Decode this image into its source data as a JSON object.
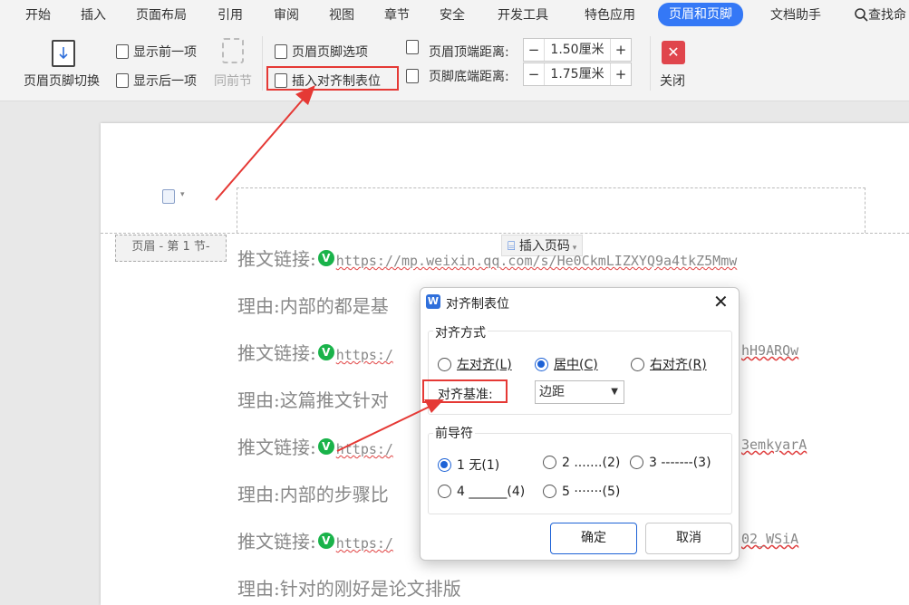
{
  "menu": {
    "tabs": [
      "开始",
      "插入",
      "页面布局",
      "引用",
      "审阅",
      "视图",
      "章节",
      "安全",
      "开发工具",
      "特色应用",
      "页眉和页脚",
      "文档助手"
    ],
    "active_tab": "页眉和页脚",
    "search_label": "查找命"
  },
  "ribbon": {
    "switch_label": "页眉页脚切换",
    "show_prev": "显示前一项",
    "show_next": "显示后一项",
    "same_section": "同前节",
    "hf_options": "页眉页脚选项",
    "insert_tab": "插入对齐制表位",
    "header_top_label": "页眉顶端距离:",
    "header_top_value": "1.50厘米",
    "footer_bottom_label": "页脚底端距离:",
    "footer_bottom_value": "1.75厘米",
    "minus": "−",
    "plus": "+",
    "close_label": "关闭",
    "close_icon": "✕"
  },
  "document": {
    "header_tag": "页眉 - 第 1 节-",
    "insert_page_number": "插入页码",
    "lines": [
      {
        "prefix": "推文链接:",
        "link": "https://mp.weixin.qq.com/s/He0CkmLIZXYQ9a4tkZ5Mmw"
      },
      {
        "prefix": "理由:内部的都是基"
      },
      {
        "prefix": "推文链接:",
        "link": "https:/",
        "tail": "hH9ARQw"
      },
      {
        "prefix": "理由:这篇推文针对"
      },
      {
        "prefix": "推文链接:",
        "link": "https:/",
        "tail": "3emkyarA"
      },
      {
        "prefix": "理由:内部的步骤比"
      },
      {
        "prefix": "推文链接:",
        "link": "https:/",
        "tail": "02_WSiA"
      },
      {
        "prefix": "理由:针对的刚好是论文排版"
      }
    ]
  },
  "dialog": {
    "title": "对齐制表位",
    "close_icon": "✕",
    "align_group": "对齐方式",
    "align_left": "左对齐(L)",
    "align_center": "居中(C)",
    "align_right": "右对齐(R)",
    "align_base_label": "对齐基准:",
    "align_base_value": "边距",
    "leader_group": "前导符",
    "leader_1": "1 无(1)",
    "leader_2": "2 .......(2)",
    "leader_3": "3 -------(3)",
    "leader_4": "4 ______(4)",
    "leader_5": "5 ·······(5)",
    "ok": "确定",
    "cancel": "取消"
  },
  "colors": {
    "accent": "#3478f6",
    "annotation_red": "#e53935",
    "close_red": "#e0454c"
  }
}
